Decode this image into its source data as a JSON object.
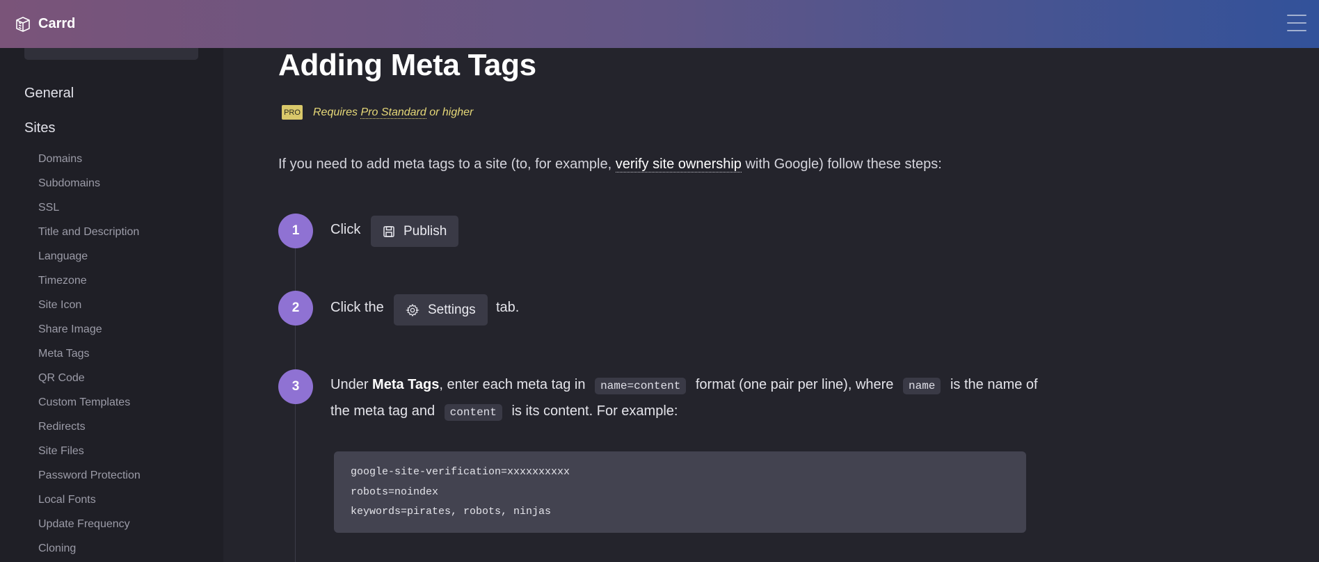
{
  "header": {
    "brand_name": "Carrd",
    "logo_icon": "carrd-logo-icon",
    "menu_icon": "hamburger-menu-icon"
  },
  "sidebar": {
    "sections": [
      {
        "label": "General"
      },
      {
        "label": "Sites"
      }
    ],
    "items": [
      {
        "label": "Domains"
      },
      {
        "label": "Subdomains"
      },
      {
        "label": "SSL"
      },
      {
        "label": "Title and Description"
      },
      {
        "label": "Language"
      },
      {
        "label": "Timezone"
      },
      {
        "label": "Site Icon"
      },
      {
        "label": "Share Image"
      },
      {
        "label": "Meta Tags"
      },
      {
        "label": "QR Code"
      },
      {
        "label": "Custom Templates"
      },
      {
        "label": "Redirects"
      },
      {
        "label": "Site Files"
      },
      {
        "label": "Password Protection"
      },
      {
        "label": "Local Fonts"
      },
      {
        "label": "Update Frequency"
      },
      {
        "label": "Cloning"
      }
    ]
  },
  "main": {
    "title": "Adding Meta Tags",
    "pro_badge": "PRO",
    "pro_requires": "Requires",
    "pro_plan": "Pro Standard",
    "pro_suffix": "or higher",
    "intro_before": "If you need to add meta tags to a site (to, for example,",
    "intro_link": "verify site ownership",
    "intro_after": "with Google) follow these steps:",
    "steps": [
      {
        "number": "1",
        "text_before": "Click",
        "button_label": "Publish",
        "button_icon": "save-icon",
        "text_after": ""
      },
      {
        "number": "2",
        "text_before": "Click the",
        "button_label": "Settings",
        "button_icon": "gear-icon",
        "text_after": "tab."
      },
      {
        "number": "3",
        "t1": "Under",
        "bold": "Meta Tags",
        "t2": ", enter each meta tag in",
        "code1": "name=content",
        "t3": "format (one pair per line), where",
        "code2": "name",
        "t4": "is the name of the meta tag and",
        "code3": "content",
        "t5": "is its content. For example:"
      }
    ],
    "code_lines": [
      "google-site-verification=xxxxxxxxxx",
      "robots=noindex",
      "keywords=pirates, robots, ninjas"
    ]
  }
}
